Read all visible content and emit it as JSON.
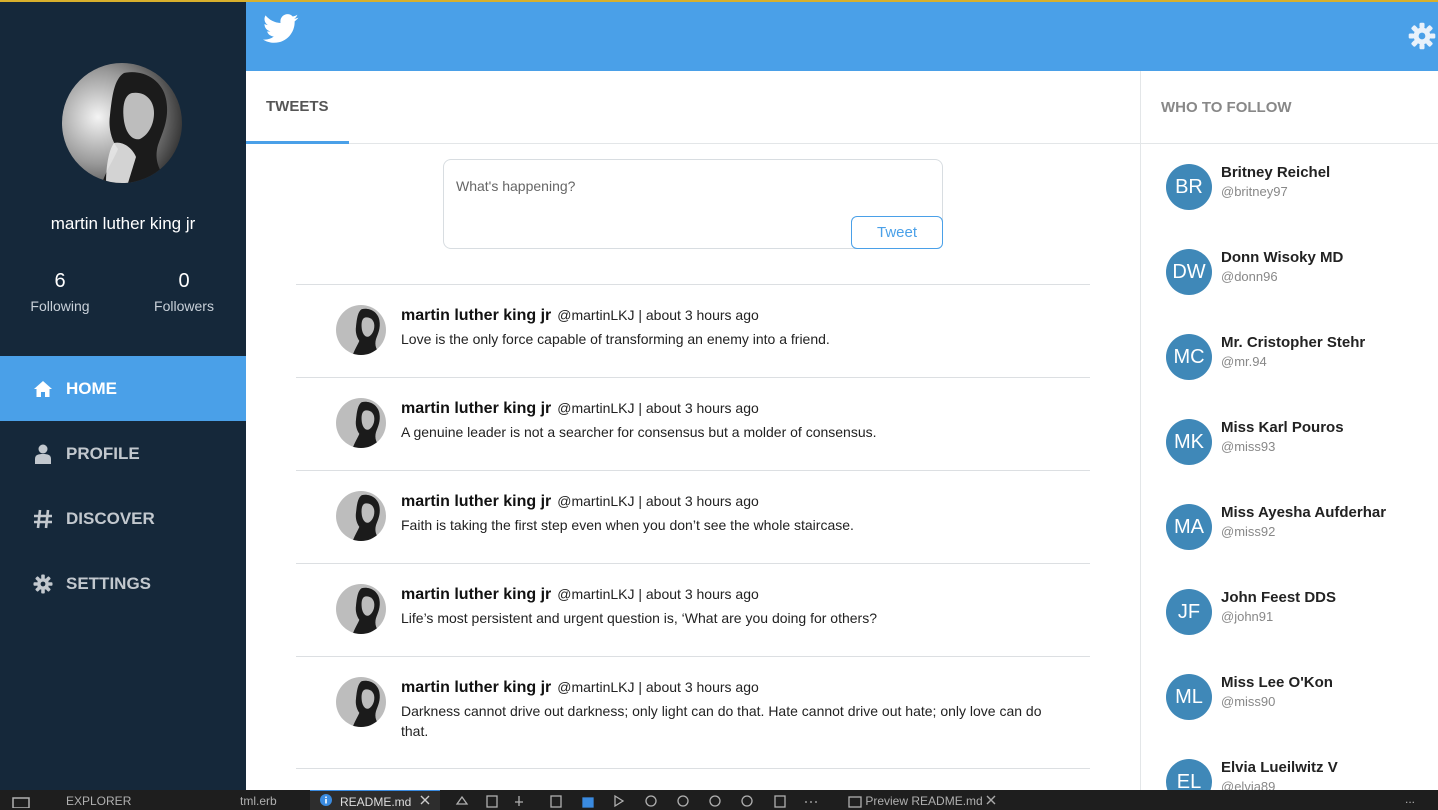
{
  "sidebar": {
    "profile_name": "martin luther king jr",
    "stats": {
      "following_count": "6",
      "following_label": "Following",
      "followers_count": "0",
      "followers_label": "Followers"
    },
    "nav": [
      {
        "label": "HOME",
        "icon": "home-icon"
      },
      {
        "label": "PROFILE",
        "icon": "user-icon"
      },
      {
        "label": "DISCOVER",
        "icon": "hashtag-icon"
      },
      {
        "label": "SETTINGS",
        "icon": "gear-icon"
      }
    ]
  },
  "colors": {
    "sidebar_bg": "#15283a",
    "accent": "#4aa0e8",
    "avatar_bg": "#3f88b8"
  },
  "tabs": {
    "tweets_label": "TWEETS"
  },
  "compose": {
    "placeholder": "What's happening?",
    "button_label": "Tweet"
  },
  "tweets": [
    {
      "name": "martin luther king jr",
      "meta": "@martinLKJ | about 3 hours ago",
      "text": "Love is the only force capable of transforming an enemy into a friend."
    },
    {
      "name": "martin luther king jr",
      "meta": "@martinLKJ | about 3 hours ago",
      "text": "A genuine leader is not a searcher for consensus but a molder of consensus."
    },
    {
      "name": "martin luther king jr",
      "meta": "@martinLKJ | about 3 hours ago",
      "text": "Faith is taking the first step even when you don’t see the whole staircase."
    },
    {
      "name": "martin luther king jr",
      "meta": "@martinLKJ | about 3 hours ago",
      "text": "Life’s most persistent and urgent question is, ‘What are you doing for others?"
    },
    {
      "name": "martin luther king jr",
      "meta": "@martinLKJ | about 3 hours ago",
      "text": "Darkness cannot drive out darkness; only light can do that. Hate cannot drive out hate; only love can do that."
    }
  ],
  "who_to_follow": {
    "title": "WHO TO FOLLOW",
    "users": [
      {
        "initials": "BR",
        "name": "Britney Reichel",
        "handle": "@britney97"
      },
      {
        "initials": "DW",
        "name": "Donn Wisoky MD",
        "handle": "@donn96"
      },
      {
        "initials": "MC",
        "name": "Mr. Cristopher Stehr",
        "handle": "@mr.94"
      },
      {
        "initials": "MK",
        "name": "Miss Karl Pouros",
        "handle": "@miss93"
      },
      {
        "initials": "MA",
        "name": "Miss Ayesha Aufderhar",
        "handle": "@miss92"
      },
      {
        "initials": "JF",
        "name": "John Feest DDS",
        "handle": "@john91"
      },
      {
        "initials": "ML",
        "name": "Miss Lee O'Kon",
        "handle": "@miss90"
      },
      {
        "initials": "EL",
        "name": "Elvia Lueilwitz V",
        "handle": "@elvia89"
      }
    ]
  },
  "vscode_bar": {
    "explorer": "EXPLORER",
    "file_tab": "tml.erb",
    "readme_tab": "README.md",
    "preview_tab": "Preview README.md",
    "more": "..."
  }
}
